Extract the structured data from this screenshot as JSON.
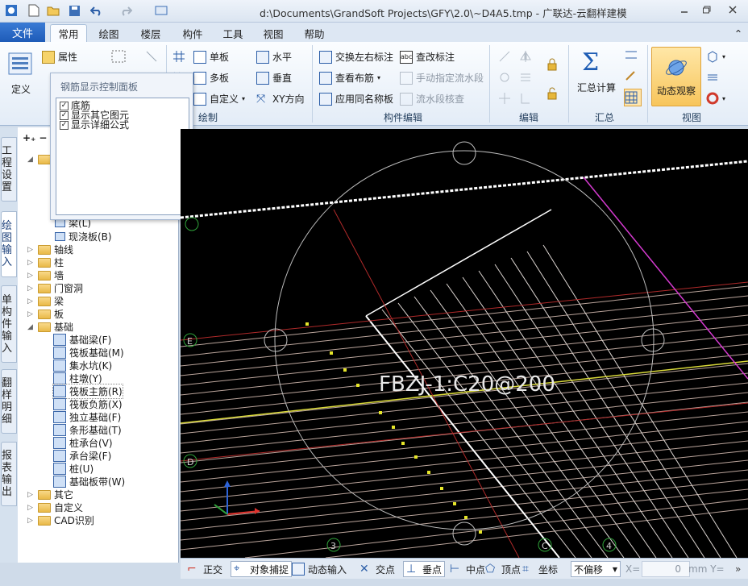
{
  "window": {
    "title": "d:\\Documents\\GrandSoft Projects\\GFY\\2.0\\~D4A5.tmp - 广联达-云翻样建模"
  },
  "tabs": {
    "file": "文件",
    "items": [
      "常用",
      "绘图",
      "楼层",
      "构件",
      "工具",
      "视图",
      "帮助"
    ],
    "active": 0
  },
  "ribbon": {
    "define": "定义",
    "attribute": "属性",
    "draw": {
      "label": "绘制",
      "single_slab": "单板",
      "multi_slab": "多板",
      "custom": "自定义",
      "horizontal": "水平",
      "vertical": "垂直",
      "xy_direction": "XY方向"
    },
    "component_edit": {
      "label": "构件编辑",
      "swap_lr_label": "交换左右标注",
      "check_label": "查改标注",
      "view_layout": "查看布筋",
      "manual_flow": "手动指定流水段",
      "apply_same_name": "应用同名称板",
      "flow_check": "流水段核查"
    },
    "edit": {
      "label": "编辑"
    },
    "summary": {
      "label": "汇总",
      "calc": "汇总计算"
    },
    "view": {
      "label": "视图",
      "dynamic_view": "动态观察"
    }
  },
  "popup": {
    "title": "钢筋显示控制面板",
    "options": [
      {
        "label": "底筋",
        "checked": true
      },
      {
        "label": "显示其它图元",
        "checked": true
      },
      {
        "label": "显示详细公式",
        "checked": true
      }
    ]
  },
  "left_tabs": [
    "工程设置",
    "绘图输入",
    "单构件输入",
    "翻样明细",
    "报表输出"
  ],
  "tree": {
    "partial": [
      {
        "label": "梁(L)"
      },
      {
        "label": "现浇板(B)"
      }
    ],
    "folders": [
      "轴线",
      "柱",
      "墙",
      "门窗洞",
      "梁",
      "板"
    ],
    "foundation": {
      "label": "基础",
      "children": [
        "基础梁(F)",
        "筏板基础(M)",
        "集水坑(K)",
        "柱墩(Y)",
        "筏板主筋(R)",
        "筏板负筋(X)",
        "独立基础(F)",
        "条形基础(T)",
        "桩承台(V)",
        "承台梁(F)",
        "桩(U)",
        "基础板带(W)"
      ]
    },
    "tail_folders": [
      "其它",
      "自定义",
      "CAD识别"
    ]
  },
  "canvas": {
    "label": "FBZJ-1:C20@200",
    "axis_labels": [
      "E",
      "D",
      "3",
      "4",
      "C"
    ]
  },
  "statusbar": {
    "ortho": "正交",
    "snap": "对象捕捉",
    "dynamic_input": "动态输入",
    "intersection": "交点",
    "perpendicular": "垂点",
    "midpoint": "中点",
    "vertex": "顶点",
    "coordinate": "坐标",
    "offset_select": "不偏移",
    "x_label": "X=",
    "x_value": "0",
    "unit_y": "mm Y="
  },
  "colors": {
    "canvas_bg": "#000000",
    "ribbon_accent": "#1e5bb8"
  }
}
